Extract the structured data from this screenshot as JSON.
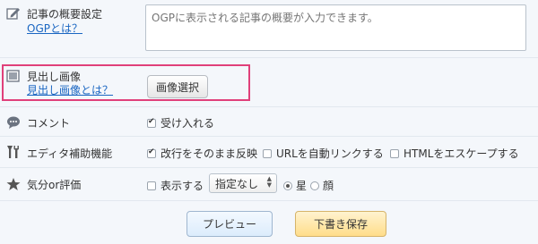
{
  "summary": {
    "label": "記事の概要設定",
    "link": "OGPとは？",
    "placeholder": "OGPに表示される記事の概要が入力できます。"
  },
  "heading_image": {
    "label": "見出し画像",
    "link": "見出し画像とは？",
    "button": "画像選択"
  },
  "comment": {
    "label": "コメント",
    "accept": "受け入れる",
    "accept_checked": true
  },
  "editor": {
    "label": "エディタ補助機能",
    "options": [
      {
        "label": "改行をそのまま反映",
        "checked": true
      },
      {
        "label": "URLを自動リンクする",
        "checked": false
      },
      {
        "label": "HTMLをエスケープする",
        "checked": false
      }
    ]
  },
  "mood": {
    "label": "気分or評価",
    "display": "表示する",
    "display_checked": false,
    "select_value": "指定なし",
    "star": "星",
    "face": "顔",
    "selected": "star"
  },
  "actions": {
    "preview": "プレビュー",
    "save_draft": "下書き保存"
  },
  "colors": {
    "highlight_border": "#e0407a",
    "link": "#1a66c2",
    "preview_bg": "#eaf4ff",
    "draft_bg": "#ffe7a8"
  }
}
